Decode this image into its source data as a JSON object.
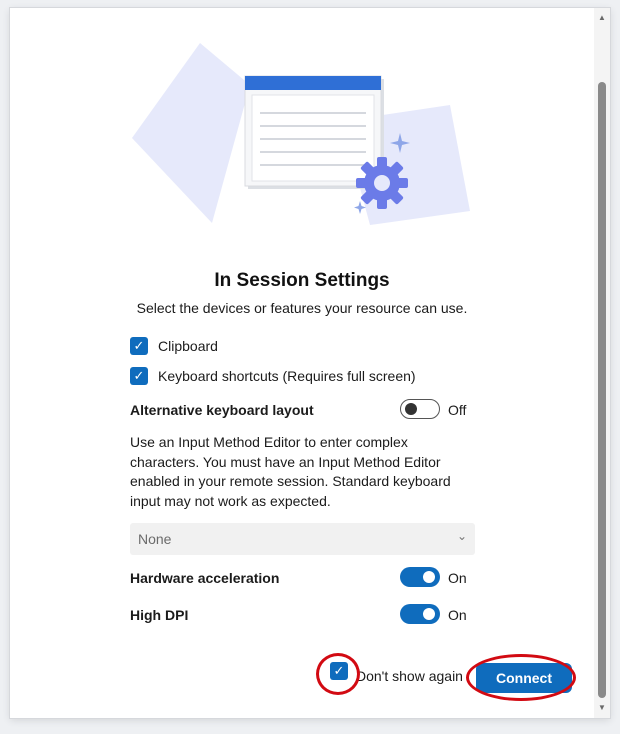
{
  "dialog": {
    "title": "In Session Settings",
    "subtitle": "Select the devices or features your resource can use."
  },
  "options": {
    "clipboard": {
      "label": "Clipboard",
      "checked": true
    },
    "keyboard_shortcuts": {
      "label": "Keyboard shortcuts (Requires full screen)",
      "checked": true
    }
  },
  "toggles": {
    "alt_keyboard": {
      "label": "Alternative keyboard layout",
      "state": "Off",
      "on": false
    },
    "hardware_accel": {
      "label": "Hardware acceleration",
      "state": "On",
      "on": true
    },
    "high_dpi": {
      "label": "High DPI",
      "state": "On",
      "on": true
    }
  },
  "ime_description": "Use an Input Method Editor to enter complex characters. You must have an Input Method Editor enabled in your remote session. Standard keyboard input may not work as expected.",
  "layout_select": {
    "value": "None"
  },
  "footer": {
    "dont_show_again": {
      "label": "Don't show again",
      "checked": true
    },
    "connect_label": "Connect"
  },
  "icons": {
    "check": "check-icon",
    "chevron": "chevron-down-icon",
    "settings": "gear-icon"
  },
  "colors": {
    "accent": "#0f6cbd",
    "annotation": "#d20a12"
  }
}
